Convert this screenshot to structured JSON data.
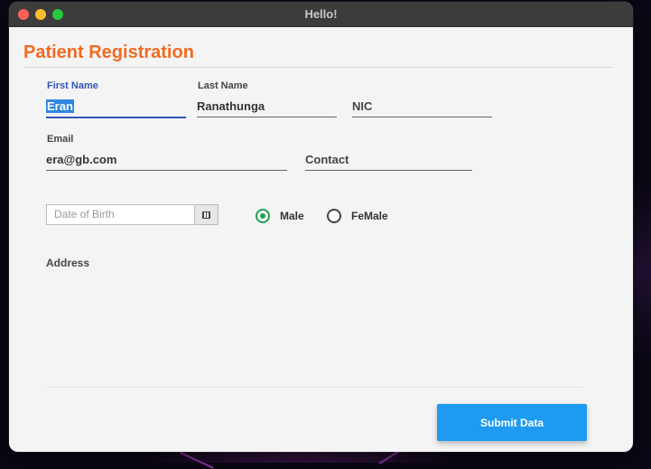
{
  "window": {
    "title": "Hello!"
  },
  "page": {
    "title": "Patient Registration"
  },
  "form": {
    "first_name": {
      "label": "First Name",
      "value": "Eran"
    },
    "last_name": {
      "label": "Last Name",
      "value": "Ranathunga"
    },
    "nic": {
      "placeholder": "NIC"
    },
    "email": {
      "label": "Email",
      "value": "era@gb.com"
    },
    "contact": {
      "placeholder": "Contact"
    },
    "dob": {
      "placeholder": "Date of Birth"
    },
    "gender": {
      "options": [
        {
          "label": "Male",
          "selected": true
        },
        {
          "label": "FeMale",
          "selected": false
        }
      ]
    },
    "address": {
      "label": "Address"
    }
  },
  "actions": {
    "submit_label": "Submit Data"
  },
  "icons": {
    "calendar": "calendar-icon"
  },
  "colors": {
    "title_accent": "#f26a21",
    "focus": "#3355bb",
    "radio_selected": "#1f9e55",
    "submit_button": "#1e9bf0"
  }
}
